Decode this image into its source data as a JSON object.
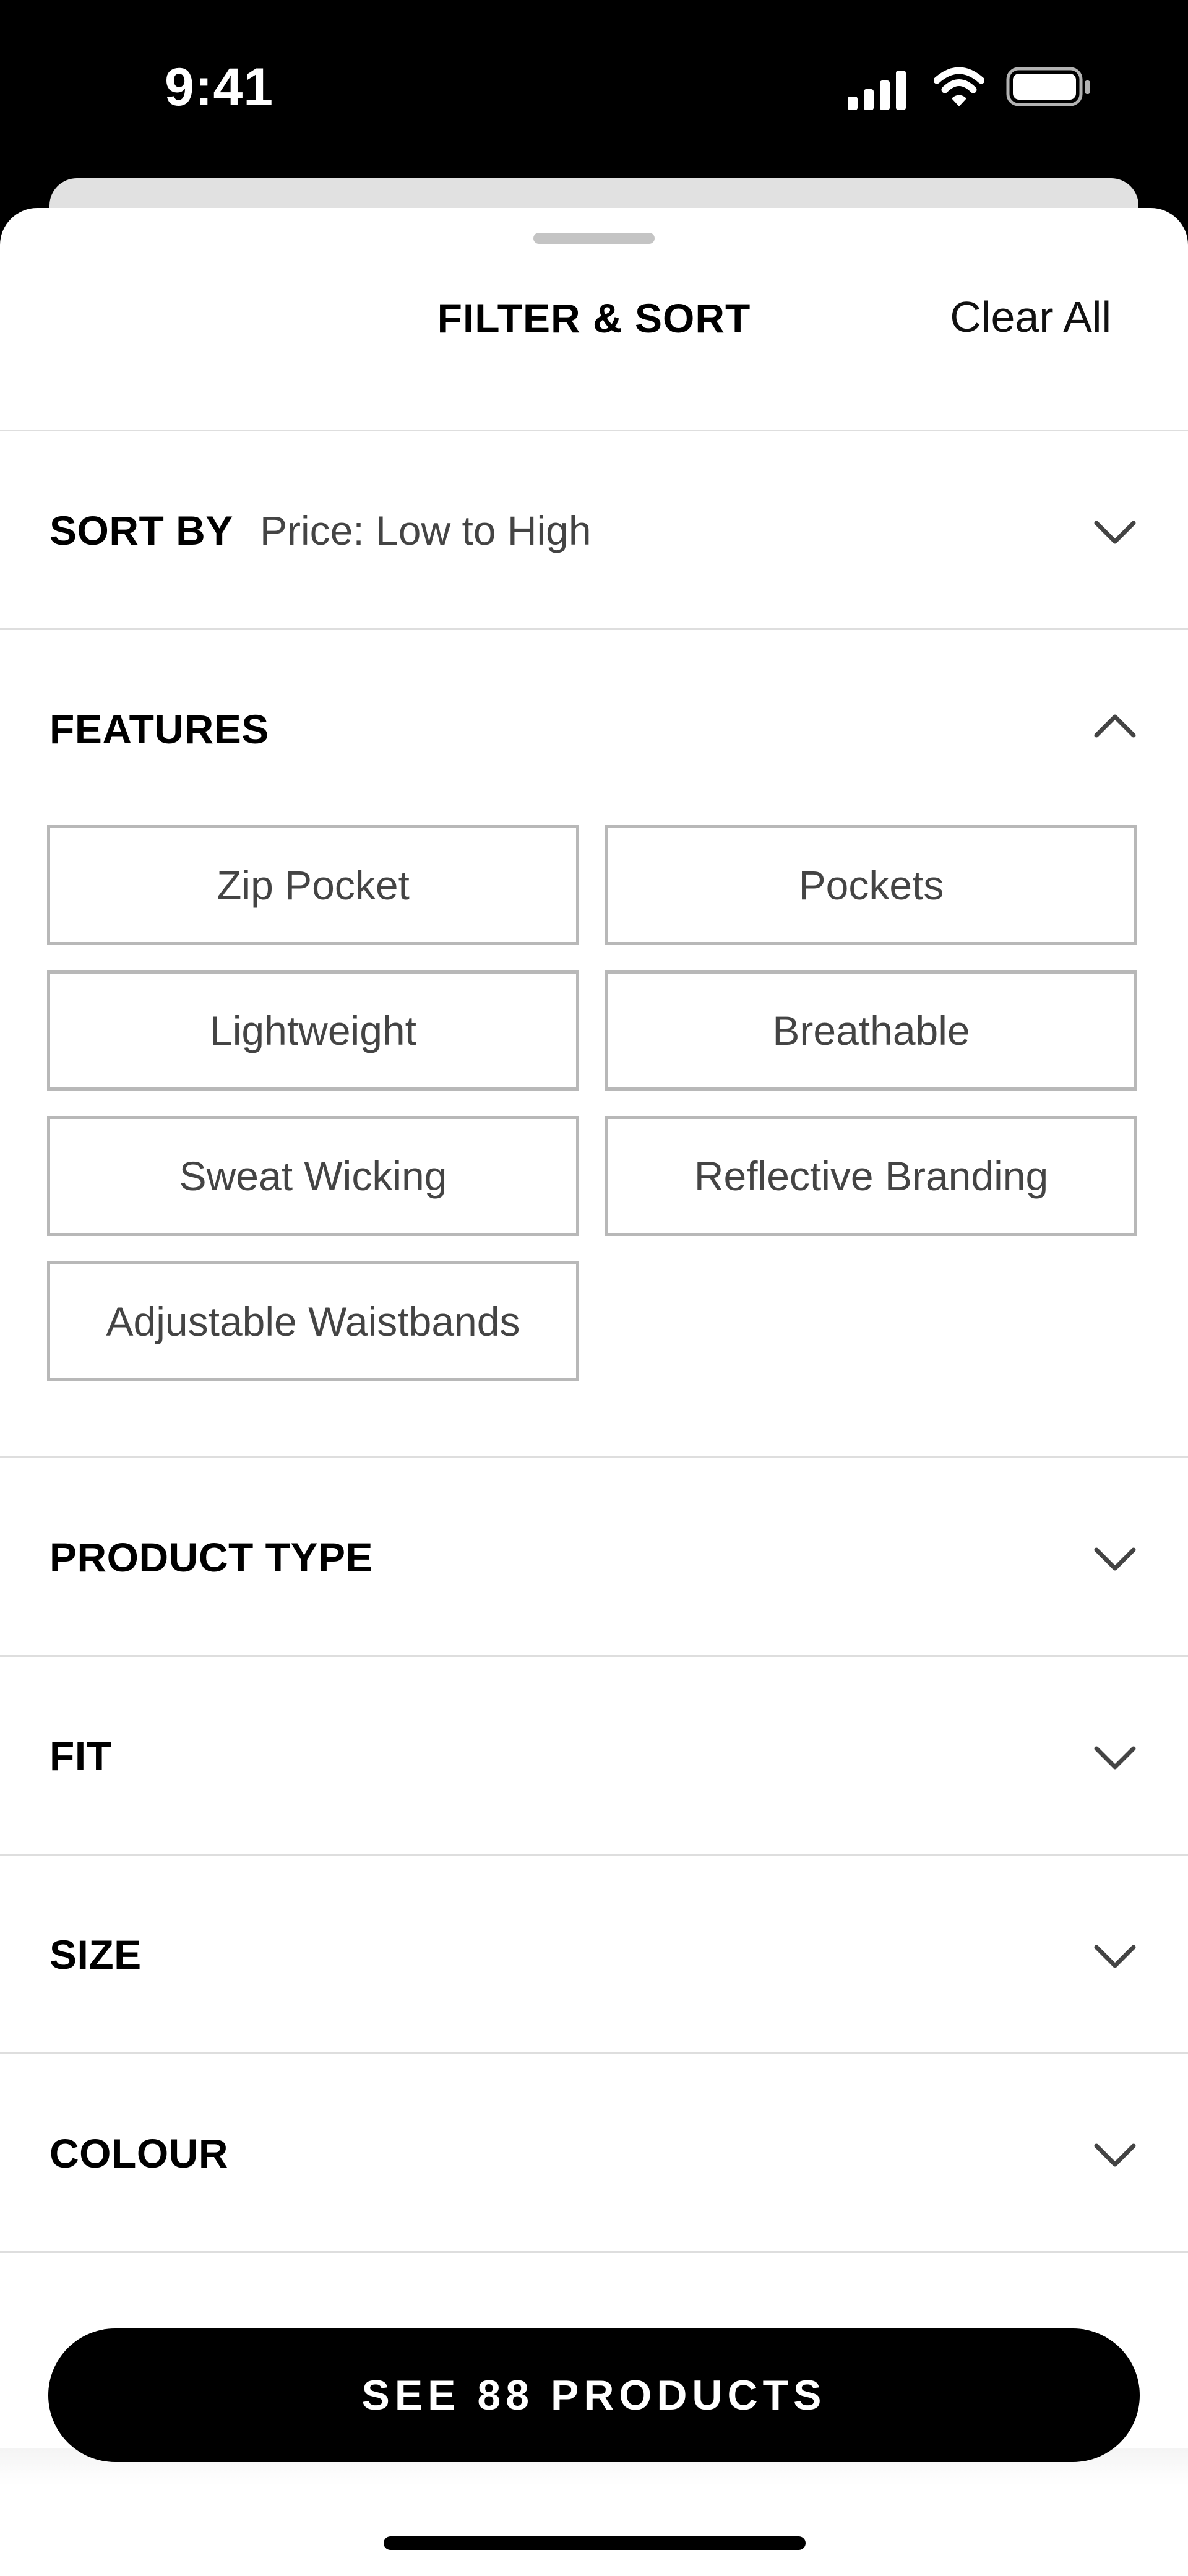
{
  "status_bar": {
    "time": "9:41",
    "icons": [
      "signal-icon",
      "wifi-icon",
      "battery-icon"
    ]
  },
  "header": {
    "title": "FILTER & SORT",
    "clear_all": "Clear All"
  },
  "sort": {
    "label": "SORT BY",
    "value": "Price: Low to High"
  },
  "features": {
    "label": "FEATURES",
    "expanded": true,
    "options": [
      "Zip Pocket",
      "Pockets",
      "Lightweight",
      "Breathable",
      "Sweat Wicking",
      "Reflective Branding",
      "Adjustable Waistbands"
    ]
  },
  "sections": [
    "PRODUCT TYPE",
    "FIT",
    "SIZE",
    "COLOUR"
  ],
  "cta": {
    "label": "SEE 88 PRODUCTS"
  },
  "colors": {
    "accent": "#000000",
    "chip_border": "#b8b8b8",
    "divider": "#dedede",
    "back_sheet": "#e1e1e1"
  }
}
